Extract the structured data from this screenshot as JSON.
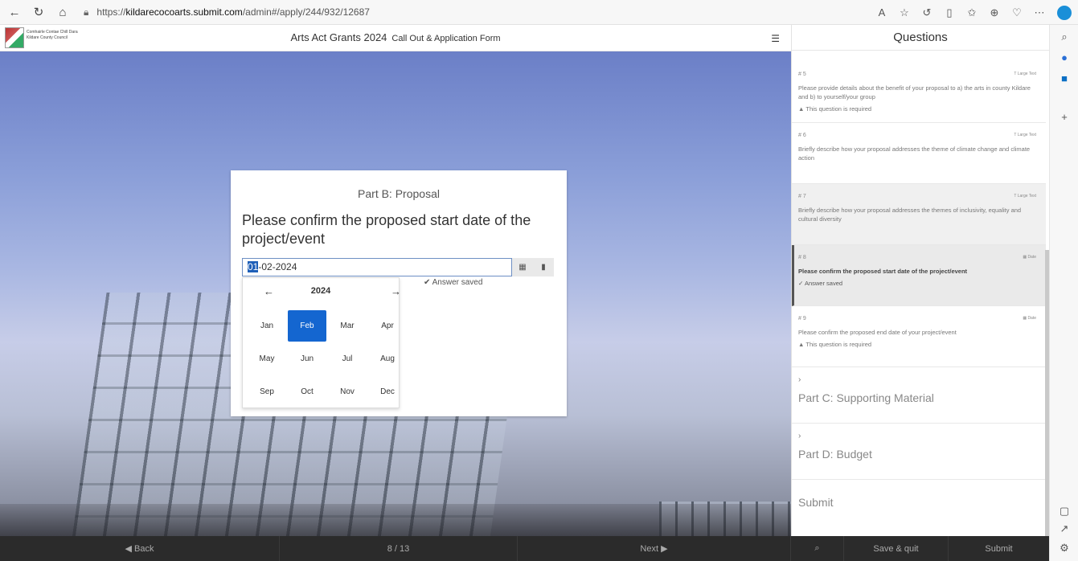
{
  "browser": {
    "url_prefix": "https://",
    "url_host": "kildarecocoarts.submit.com",
    "url_path": "/admin#/apply/244/932/12687"
  },
  "header": {
    "org_line1": "Comhairle Contae Chill Dara",
    "org_line2": "Kildare County Council",
    "title": "Arts Act Grants 2024",
    "subtitle": "Call Out & Application Form"
  },
  "form": {
    "part_title": "Part B: Proposal",
    "question": "Please confirm the proposed start date of the project/event",
    "date_selected_part": "01",
    "date_rest": "-02-2024",
    "saved_text": "Answer saved",
    "picker": {
      "year": "2024",
      "months": [
        "Jan",
        "Feb",
        "Mar",
        "Apr",
        "May",
        "Jun",
        "Jul",
        "Aug",
        "Sep",
        "Oct",
        "Nov",
        "Dec"
      ],
      "selected_month": "Feb"
    }
  },
  "questions_panel": {
    "title": "Questions",
    "items": [
      {
        "num": "# 5",
        "type": "Large Text",
        "text": "Please provide details about the benefit of your proposal to a) the arts in county Kildare and b) to yourself/your group",
        "status": "This question is required"
      },
      {
        "num": "# 6",
        "type": "Large Text",
        "text": "Briefly describe how your proposal addresses the theme of climate change and climate action",
        "status": ""
      },
      {
        "num": "# 7",
        "type": "Large Text",
        "text": "Briefly describe how your proposal addresses the themes of inclusivity, equality and cultural diversity",
        "status": ""
      },
      {
        "num": "# 8",
        "type": "Date",
        "text": "Please confirm the proposed start date of the project/event",
        "status": "Answer saved"
      },
      {
        "num": "# 9",
        "type": "Date",
        "text": "Please confirm the proposed end date of your project/event",
        "status": "This question is required"
      }
    ],
    "sections": [
      "Part C: Supporting Material",
      "Part D: Budget"
    ],
    "submit": "Submit"
  },
  "footer": {
    "back": "Back",
    "progress": "8 / 13",
    "next": "Next",
    "save_quit": "Save & quit",
    "submit": "Submit"
  }
}
